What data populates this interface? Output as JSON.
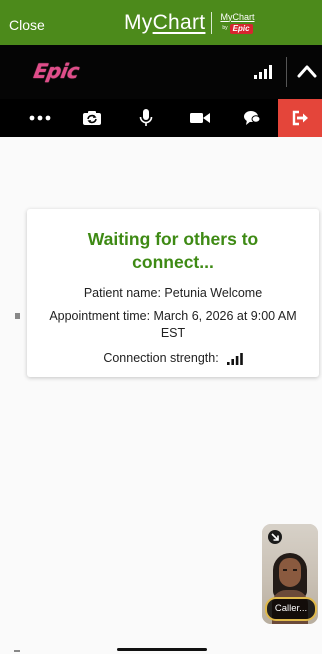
{
  "header": {
    "close_label": "Close",
    "brand_name_prefix": "My",
    "brand_name_suffix": "Chart",
    "brand_small": "MyChart",
    "brand_by": "by",
    "brand_small_logo": "Epic"
  },
  "epic_bar": {
    "logo_text": "Epic",
    "signal_icon": "signal-bars-icon",
    "collapse_icon": "chevron-up-icon"
  },
  "toolbar": {
    "items": [
      {
        "icon": "more-options-icon"
      },
      {
        "icon": "switch-camera-icon"
      },
      {
        "icon": "microphone-icon"
      },
      {
        "icon": "video-camera-icon"
      },
      {
        "icon": "chat-icon"
      },
      {
        "icon": "leave-call-icon"
      }
    ],
    "leave_color": "#e4453a"
  },
  "waiting_card": {
    "title": "Waiting for others to connect...",
    "patient_line": "Patient name: Petunia Welcome",
    "appointment_line": "Appointment time: March 6, 2026 at 9:00 AM EST",
    "connection_label": "Connection strength:",
    "connection_icon": "signal-strength-icon",
    "title_color": "#3e8a14"
  },
  "self_view": {
    "caller_label": "Caller...",
    "minimize_icon": "minimize-arrow-icon"
  },
  "colors": {
    "mychart_green": "#4c8a1b",
    "epic_pink": "#e04d8a"
  }
}
